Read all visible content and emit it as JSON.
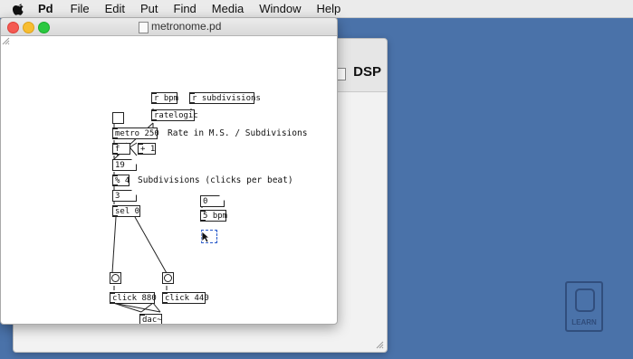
{
  "menubar": {
    "app_name": "Pd",
    "items": [
      "File",
      "Edit",
      "Put",
      "Find",
      "Media",
      "Window",
      "Help"
    ]
  },
  "main_window": {
    "dsp_label": "DSP"
  },
  "patch_window": {
    "title": "metronome.pd",
    "objects": {
      "r_bpm": "r bpm",
      "r_subdivisions": "r subdivisions",
      "ratelogic": "ratelogic",
      "metro": "metro 250",
      "float": "f",
      "plus": "+ 1",
      "mod": "% 4",
      "sel": "sel 0",
      "click_880": "click 880",
      "click_440": "click 440",
      "dac": "dac~"
    },
    "numbers": {
      "counter": "19",
      "beat": "3",
      "subdivisions": "0",
      "bpm": "5 bpm"
    },
    "comments": {
      "rate": "Rate in M.S. / Subdivisions",
      "subdivisions": "Subdivisions (clicks per beat)"
    }
  },
  "icons": {
    "apple": "apple-logo-icon",
    "doc": "document-icon"
  },
  "watermark": {
    "text": "LEARN"
  },
  "colors": {
    "desktop": "#4a72a9",
    "close": "#f45a52",
    "minimize": "#f7bd31",
    "zoom": "#2bc840",
    "selection": "#2557c9"
  }
}
